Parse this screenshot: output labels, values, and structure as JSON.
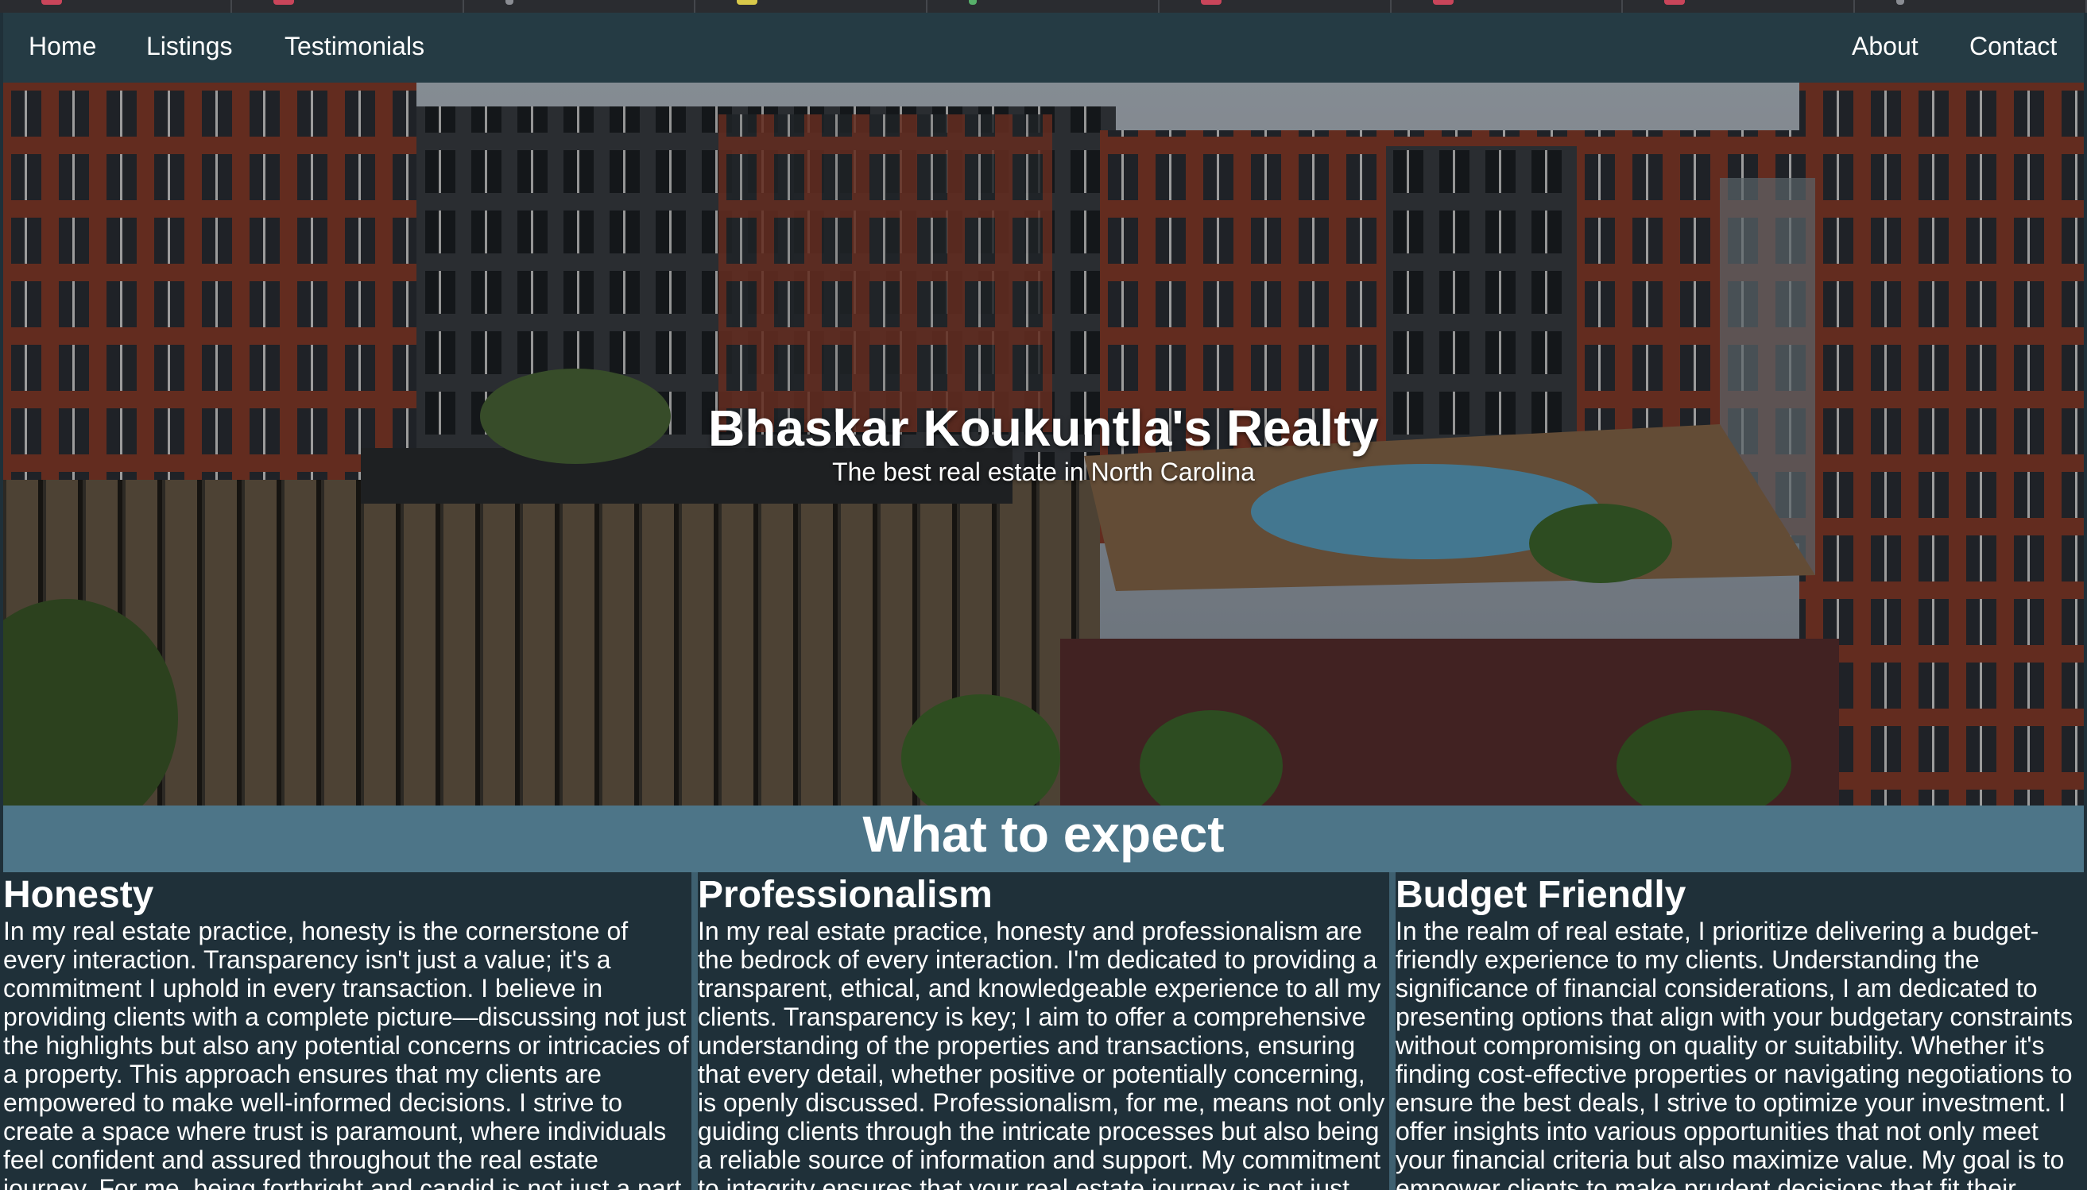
{
  "browser": {
    "tab_count": 9
  },
  "nav": {
    "left": [
      "Home",
      "Listings",
      "Testimonials"
    ],
    "right": [
      "About",
      "Contact"
    ]
  },
  "hero": {
    "title": "Bhaskar Koukuntla's Realty",
    "subtitle": "The best real estate in North Carolina"
  },
  "section": {
    "title": "What to expect"
  },
  "features": [
    {
      "title": "Honesty",
      "text": "In my real estate practice, honesty is the cornerstone of every interaction. Transparency isn't just a value; it's a commitment I uphold in every transaction. I believe in providing clients with a complete picture—discussing not just the highlights but also any potential concerns or intricacies of a property. This approach ensures that my clients are empowered to make well-informed decisions. I strive to create a space where trust is paramount, where individuals feel confident and assured throughout the real estate journey. For me, being forthright and candid is not just a part"
    },
    {
      "title": "Professionalism",
      "text": "In my real estate practice, honesty and professionalism are the bedrock of every interaction. I'm dedicated to providing a transparent, ethical, and knowledgeable experience to all my clients. Transparency is key; I aim to offer a comprehensive understanding of the properties and transactions, ensuring that every detail, whether positive or potentially concerning, is openly discussed. Professionalism, for me, means not only guiding clients through the intricate processes but also being a reliable source of information and support. My commitment to integrity ensures that your real estate journey is not just"
    },
    {
      "title": "Budget Friendly",
      "text": "In the realm of real estate, I prioritize delivering a budget-friendly experience to my clients. Understanding the significance of financial considerations, I am dedicated to presenting options that align with your budgetary constraints without compromising on quality or suitability. Whether it's finding cost-effective properties or navigating negotiations to ensure the best deals, I strive to optimize your investment. I offer insights into various opportunities that not only meet your financial criteria but also maximize value. My goal is to empower clients to make prudent decisions that fit their"
    }
  ],
  "colors": {
    "nav_bg": "#253b44",
    "band_bg": "#4d7588",
    "body_bg": "#1f3039",
    "text": "#ffffff"
  }
}
